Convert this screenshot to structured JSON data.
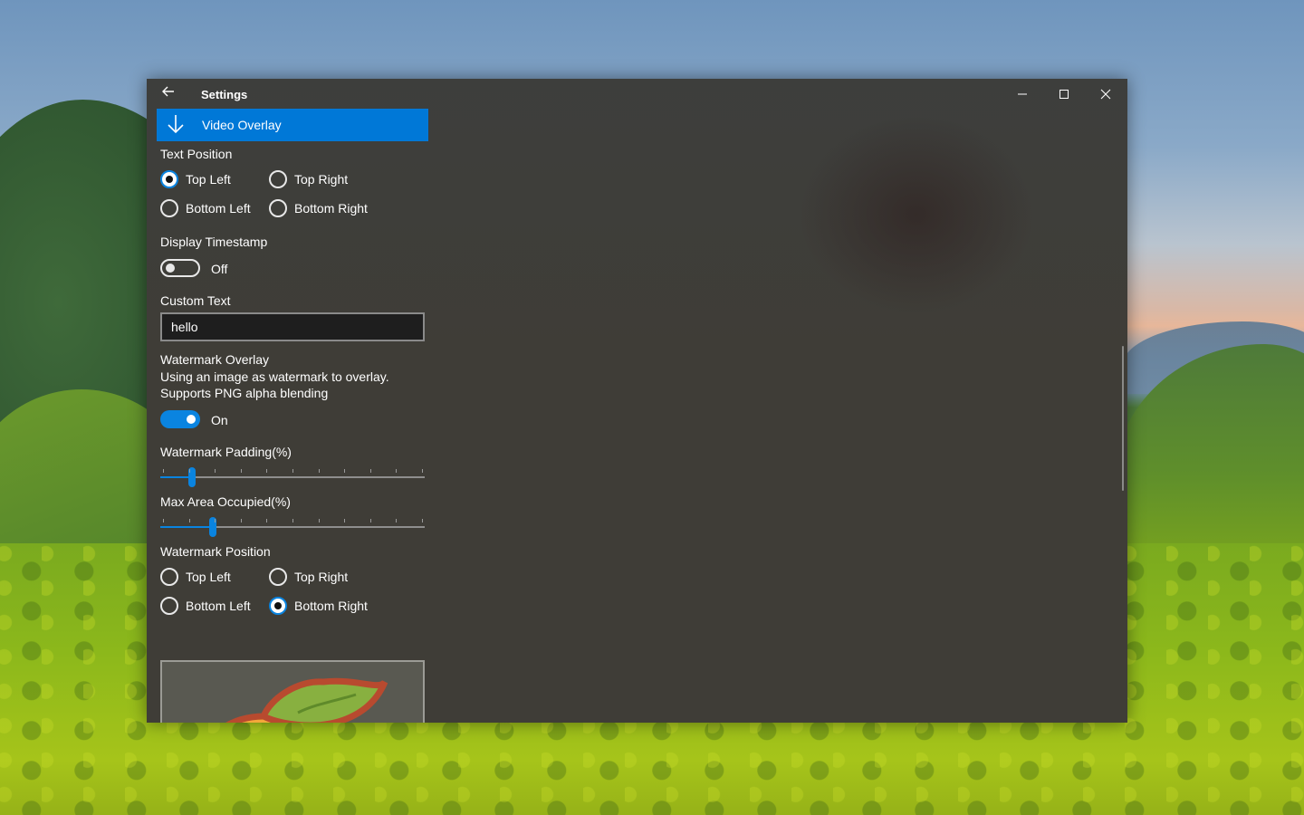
{
  "window": {
    "title": "Settings",
    "back_icon": "back-arrow-icon",
    "caption_buttons": [
      "minimize-icon",
      "maximize-icon",
      "close-icon"
    ]
  },
  "section": {
    "label": "Video Overlay",
    "icon": "down-arrow-icon",
    "accent": "#0078d7"
  },
  "text_position": {
    "label": "Text Position",
    "options": [
      "Top Left",
      "Top Right",
      "Bottom Left",
      "Bottom Right"
    ],
    "selected": "Top Left"
  },
  "display_timestamp": {
    "label": "Display Timestamp",
    "state_text": "Off",
    "on": false
  },
  "custom_text": {
    "label": "Custom Text",
    "value": "hello"
  },
  "watermark_overlay": {
    "label": "Watermark Overlay",
    "description_line1": "Using an image as watermark to overlay.",
    "description_line2": "Supports PNG alpha blending",
    "state_text": "On",
    "on": true
  },
  "watermark_padding": {
    "label": "Watermark Padding(%)",
    "value_fraction": 0.12
  },
  "max_area": {
    "label": "Max Area Occupied(%)",
    "value_fraction": 0.2
  },
  "watermark_position": {
    "label": "Watermark Position",
    "options": [
      "Top Left",
      "Top Right",
      "Bottom Left",
      "Bottom Right"
    ],
    "selected": "Bottom Right"
  },
  "colors": {
    "accent": "#0a84e0",
    "window_bg": "#3f3d37"
  }
}
